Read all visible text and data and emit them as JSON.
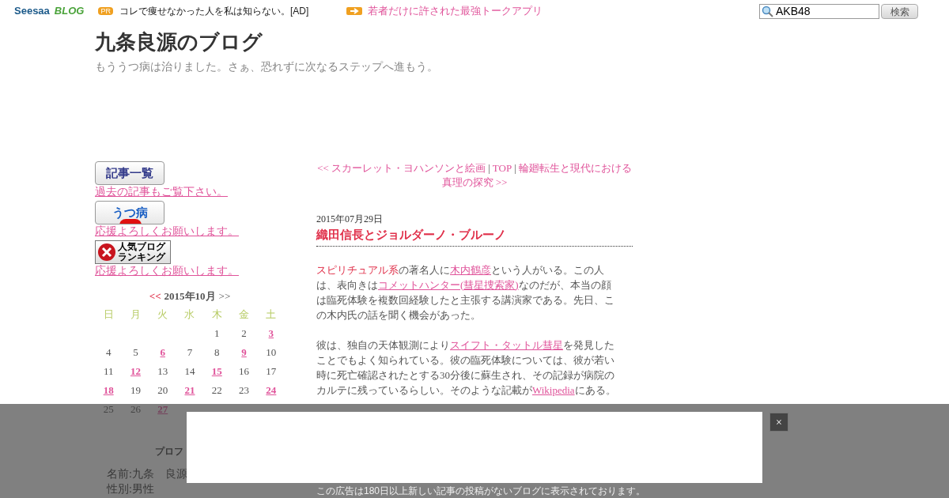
{
  "header": {
    "logo": {
      "brand": "Seesaa",
      "product": "BLOG"
    },
    "pr_badge": "PR",
    "ad_text": "コレで痩せなかった人を私は知らない。[AD]",
    "ad_link": "若者だけに許された最強トークアプリ",
    "search": {
      "value": "AKB48",
      "button": "検索"
    }
  },
  "blog": {
    "title": "九条良源のブログ",
    "tagline": "もううつ病は治りました。さぁ、恐れずに次なるステップへ進もう。"
  },
  "sidebar": {
    "banners": [
      {
        "kind": "list",
        "label": "記事一覧",
        "caption": "過去の記事もご覧下さい。"
      },
      {
        "kind": "utsu",
        "label": "うつ病",
        "caption": "応援よろしくお願いします。"
      },
      {
        "kind": "ranking",
        "label_lines": [
          "人気ブログ",
          "ランキング"
        ],
        "caption": "応援よろしくお願いします。"
      }
    ],
    "calendar": {
      "prev": "<<",
      "title": "2015年10月",
      "next": ">>",
      "weekdays": [
        "日",
        "月",
        "火",
        "水",
        "木",
        "金",
        "土"
      ],
      "weeks": [
        [
          {
            "kind": "blank"
          },
          {
            "kind": "blank"
          },
          {
            "kind": "blank"
          },
          {
            "kind": "blank"
          },
          {
            "day": "1",
            "linked": false
          },
          {
            "day": "2",
            "linked": false
          },
          {
            "day": "3",
            "linked": true
          }
        ],
        [
          {
            "day": "4",
            "linked": false
          },
          {
            "day": "5",
            "linked": false
          },
          {
            "day": "6",
            "linked": true
          },
          {
            "day": "7",
            "linked": false
          },
          {
            "day": "8",
            "linked": false
          },
          {
            "day": "9",
            "linked": true
          },
          {
            "day": "10",
            "linked": false
          }
        ],
        [
          {
            "day": "11",
            "linked": false
          },
          {
            "day": "12",
            "linked": true
          },
          {
            "day": "13",
            "linked": false
          },
          {
            "day": "14",
            "linked": false
          },
          {
            "day": "15",
            "linked": true
          },
          {
            "day": "16",
            "linked": false
          },
          {
            "day": "17",
            "linked": false
          }
        ],
        [
          {
            "day": "18",
            "linked": true
          },
          {
            "day": "19",
            "linked": false
          },
          {
            "day": "20",
            "linked": false
          },
          {
            "day": "21",
            "linked": true
          },
          {
            "day": "22",
            "linked": false
          },
          {
            "day": "23",
            "linked": false
          },
          {
            "day": "24",
            "linked": true
          }
        ],
        [
          {
            "day": "25",
            "linked": false
          },
          {
            "day": "26",
            "linked": false
          },
          {
            "day": "27",
            "linked": true
          }
        ]
      ]
    },
    "profile": {
      "heading": "プロフ",
      "lines": [
        "名前:九条　良源",
        "性別:男性"
      ]
    }
  },
  "article": {
    "nav": [
      {
        "kind": "link",
        "text": "<< スカーレット・ヨハンソンと絵画"
      },
      {
        "kind": "sep",
        "text": "|"
      },
      {
        "kind": "link",
        "text": "TOP"
      },
      {
        "kind": "sep",
        "text": "|"
      },
      {
        "kind": "link",
        "text": "輪廻転生と現代における"
      },
      {
        "kind": "link",
        "text": "真理の探究 >>"
      }
    ],
    "date": "2015年07月29日",
    "title": "織田信長とジョルダーノ・ブルーノ",
    "paragraphs": [
      [
        {
          "kind": "highlight",
          "text": "スピリチュアル系"
        },
        {
          "kind": "plain",
          "text": "の著名人に"
        },
        {
          "kind": "link",
          "text": "木内鶴彦"
        },
        {
          "kind": "plain",
          "text": "という人がいる。この人は、表向きは"
        },
        {
          "kind": "link",
          "text": "コメットハンター(彗星捜索家)"
        },
        {
          "kind": "plain",
          "text": "なのだが、本当の顔は臨死体験を複数回経験したと主張する講演家である。先日、この木内氏の話を聞く機会があった。"
        }
      ],
      [
        {
          "kind": "plain",
          "text": "彼は、独自の天体観測により"
        },
        {
          "kind": "link",
          "text": "スイフト・タットル彗星"
        },
        {
          "kind": "plain",
          "text": "を発見したことでもよく知られている。彼の臨死体験については、彼が若い時に死亡確認されたとする30分後に蘇生され、その記録が病院のカルテに残っているらしい。そのような記載が"
        },
        {
          "kind": "link",
          "text": "Wikipedia"
        },
        {
          "kind": "plain",
          "text": "にある。"
        }
      ]
    ]
  },
  "overlay": {
    "close": "×",
    "notice": "この広告は180日以上新しい記事の投稿がないブログに表示されております。"
  }
}
